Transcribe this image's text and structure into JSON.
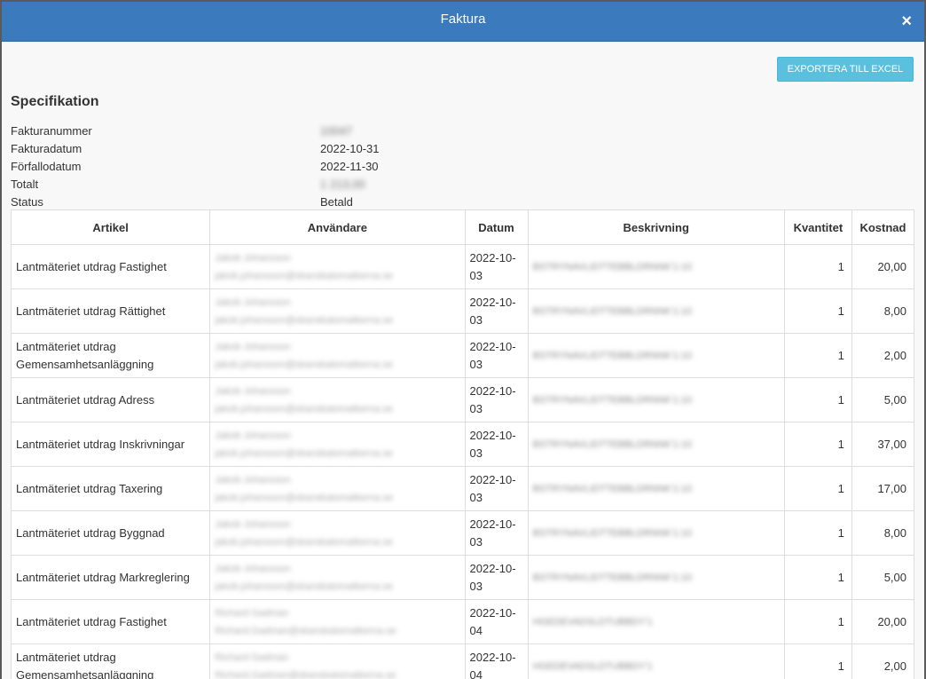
{
  "dialog": {
    "title": "Faktura",
    "close_label": "×"
  },
  "export_button": "EXPORTERA TILL EXCEL",
  "specification": {
    "heading": "Specifikation",
    "rows": [
      {
        "label": "Fakturanummer",
        "value": "10047"
      },
      {
        "label": "Fakturadatum",
        "value": "2022-10-31"
      },
      {
        "label": "Förfallodatum",
        "value": "2022-11-30"
      },
      {
        "label": "Totalt",
        "value": "1 213,00"
      },
      {
        "label": "Status",
        "value": "Betald"
      }
    ]
  },
  "table": {
    "headers": [
      "Artikel",
      "Användare",
      "Datum",
      "Beskrivning",
      "Kvantitet",
      "Kostnad"
    ],
    "rows": [
      {
        "artikel": "Lantmäteriet utdrag Fastighet",
        "user_name": "Jakob Johansson",
        "user_email": "jakob.johansson@skanskatomatkerna.se",
        "datum": "2022-10-03",
        "beskrivning": "BSTRYNAVLIDTTEBBLDRNNK'1:10",
        "kvantitet": "1",
        "kostnad": "20,00"
      },
      {
        "artikel": "Lantmäteriet utdrag Rättighet",
        "user_name": "Jakob Johansson",
        "user_email": "jakob.johansson@skanskatomatkerna.se",
        "datum": "2022-10-03",
        "beskrivning": "BSTRYNAVLIDTTEBBLDRNNK'1:10",
        "kvantitet": "1",
        "kostnad": "8,00"
      },
      {
        "artikel": "Lantmäteriet utdrag Gemensamhetsanläggning",
        "user_name": "Jakob Johansson",
        "user_email": "jakob.johansson@skanskatomatkerna.se",
        "datum": "2022-10-03",
        "beskrivning": "BSTRYNAVLIDTTEBBLDRNNK'1:10",
        "kvantitet": "1",
        "kostnad": "2,00"
      },
      {
        "artikel": "Lantmäteriet utdrag Adress",
        "user_name": "Jakob Johansson",
        "user_email": "jakob.johansson@skanskatomatkerna.se",
        "datum": "2022-10-03",
        "beskrivning": "BSTRYNAVLIDTTEBBLDRNNK'1:10",
        "kvantitet": "1",
        "kostnad": "5,00"
      },
      {
        "artikel": "Lantmäteriet utdrag Inskrivningar",
        "user_name": "Jakob Johansson",
        "user_email": "jakob.johansson@skanskatomatkerna.se",
        "datum": "2022-10-03",
        "beskrivning": "BSTRYNAVLIDTTEBBLDRNNK'1:10",
        "kvantitet": "1",
        "kostnad": "37,00"
      },
      {
        "artikel": "Lantmäteriet utdrag Taxering",
        "user_name": "Jakob Johansson",
        "user_email": "jakob.johansson@skanskatomatkerna.se",
        "datum": "2022-10-03",
        "beskrivning": "BSTRYNAVLIDTTEBBLDRNNK'1:10",
        "kvantitet": "1",
        "kostnad": "17,00"
      },
      {
        "artikel": "Lantmäteriet utdrag Byggnad",
        "user_name": "Jakob Johansson",
        "user_email": "jakob.johansson@skanskatomatkerna.se",
        "datum": "2022-10-03",
        "beskrivning": "BSTRYNAVLIDTTEBBLDRNNK'1:10",
        "kvantitet": "1",
        "kostnad": "8,00"
      },
      {
        "artikel": "Lantmäteriet utdrag Markreglering",
        "user_name": "Jakob Johansson",
        "user_email": "jakob.johansson@skanskatomatkerna.se",
        "datum": "2022-10-03",
        "beskrivning": "BSTRYNAVLIDTTEBBLDRNNK'1:10",
        "kvantitet": "1",
        "kostnad": "5,00"
      },
      {
        "artikel": "Lantmäteriet utdrag Fastighet",
        "user_name": "Richard Gadman",
        "user_email": "Richard.Gadman@skanskatomatkerna.se",
        "datum": "2022-10-04",
        "beskrivning": "HGEDEVADSLDTUBBDY'1",
        "kvantitet": "1",
        "kostnad": "20,00"
      },
      {
        "artikel": "Lantmäteriet utdrag Gemensamhetsanläggning",
        "user_name": "Richard Gadman",
        "user_email": "Richard.Gadman@skanskatomatkerna.se",
        "datum": "2022-10-04",
        "beskrivning": "HGEDEVADSLDTUBBDY'1",
        "kvantitet": "1",
        "kostnad": "2,00"
      }
    ]
  }
}
